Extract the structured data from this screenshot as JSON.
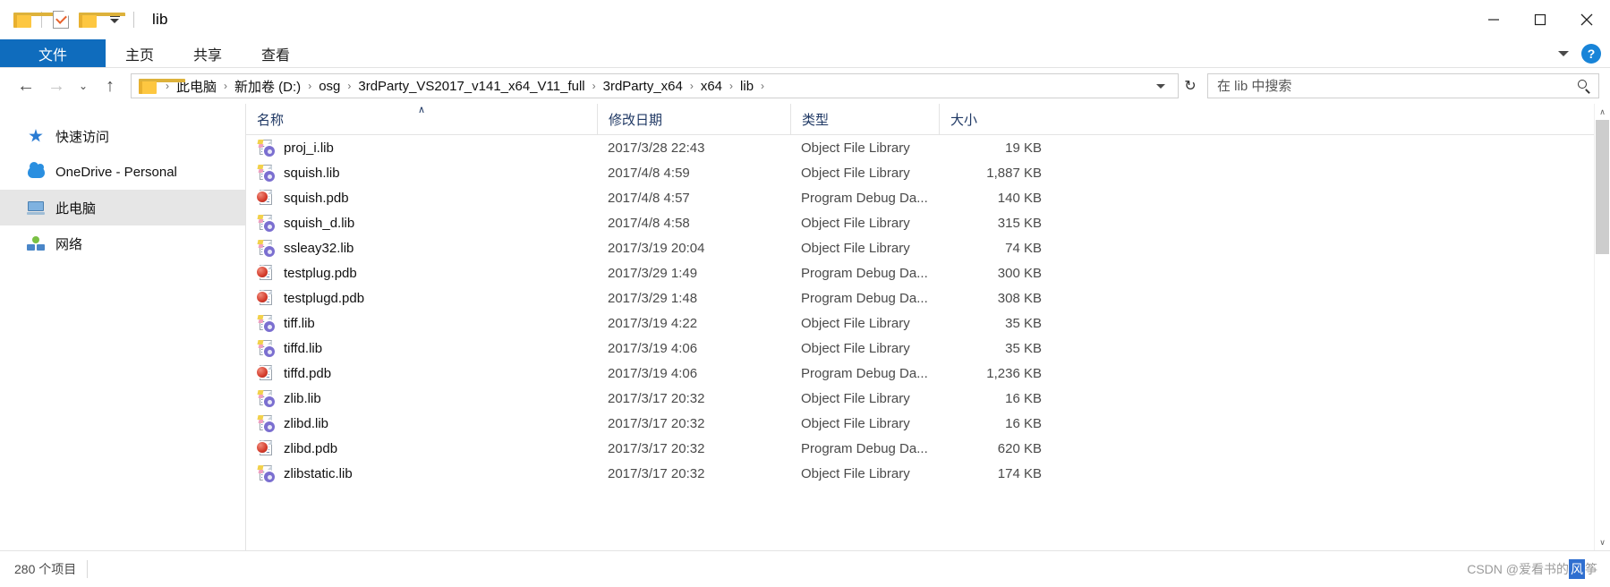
{
  "window": {
    "title": "lib",
    "quick_access": [
      {
        "name": "folder-icon",
        "label": "folder"
      },
      {
        "name": "properties-icon",
        "label": "properties"
      },
      {
        "name": "new-folder-icon",
        "label": "new folder"
      },
      {
        "name": "customize-quick-access-icon",
        "label": "customize"
      }
    ],
    "caption": {
      "minimize": "minimize-button",
      "maximize": "maximize-button",
      "close": "close-button"
    }
  },
  "ribbon": {
    "tabs": [
      {
        "label": "文件",
        "active": true
      },
      {
        "label": "主页",
        "active": false
      },
      {
        "label": "共享",
        "active": false
      },
      {
        "label": "查看",
        "active": false
      }
    ],
    "expand_icon": "chevron-down-icon",
    "help_label": "?"
  },
  "address": {
    "back": "←",
    "forward": "→",
    "recent": "⌄",
    "up": "↑",
    "folder_icon": "folder-icon",
    "crumbs": [
      "此电脑",
      "新加卷 (D:)",
      "osg",
      "3rdParty_VS2017_v141_x64_V11_full",
      "3rdParty_x64",
      "x64",
      "lib"
    ],
    "separator": "›",
    "dropdown_icon": "chevron-down-icon",
    "refresh_icon": "refresh-icon",
    "refresh_glyph": "↻"
  },
  "search": {
    "placeholder": "在 lib 中搜索",
    "value": "",
    "icon": "search-icon"
  },
  "nav_pane": {
    "items": [
      {
        "label": "快速访问",
        "icon": "pin-icon",
        "selected": false
      },
      {
        "label": "OneDrive - Personal",
        "icon": "cloud-icon",
        "selected": false
      },
      {
        "label": "此电脑",
        "icon": "computer-icon",
        "selected": true
      },
      {
        "label": "网络",
        "icon": "network-icon",
        "selected": false
      }
    ]
  },
  "file_list": {
    "columns": [
      {
        "label": "名称",
        "key": "name",
        "sorted": true,
        "sort_glyph": "∧"
      },
      {
        "label": "修改日期",
        "key": "date"
      },
      {
        "label": "类型",
        "key": "type"
      },
      {
        "label": "大小",
        "key": "size"
      }
    ],
    "rows": [
      {
        "name": "proj_i.lib",
        "date": "2017/3/28 22:43",
        "type": "Object File Library",
        "size": "19 KB",
        "icon": "lib-file-icon"
      },
      {
        "name": "squish.lib",
        "date": "2017/4/8 4:59",
        "type": "Object File Library",
        "size": "1,887 KB",
        "icon": "lib-file-icon"
      },
      {
        "name": "squish.pdb",
        "date": "2017/4/8 4:57",
        "type": "Program Debug Da...",
        "size": "140 KB",
        "icon": "pdb-file-icon"
      },
      {
        "name": "squish_d.lib",
        "date": "2017/4/8 4:58",
        "type": "Object File Library",
        "size": "315 KB",
        "icon": "lib-file-icon"
      },
      {
        "name": "ssleay32.lib",
        "date": "2017/3/19 20:04",
        "type": "Object File Library",
        "size": "74 KB",
        "icon": "lib-file-icon"
      },
      {
        "name": "testplug.pdb",
        "date": "2017/3/29 1:49",
        "type": "Program Debug Da...",
        "size": "300 KB",
        "icon": "pdb-file-icon"
      },
      {
        "name": "testplugd.pdb",
        "date": "2017/3/29 1:48",
        "type": "Program Debug Da...",
        "size": "308 KB",
        "icon": "pdb-file-icon"
      },
      {
        "name": "tiff.lib",
        "date": "2017/3/19 4:22",
        "type": "Object File Library",
        "size": "35 KB",
        "icon": "lib-file-icon"
      },
      {
        "name": "tiffd.lib",
        "date": "2017/3/19 4:06",
        "type": "Object File Library",
        "size": "35 KB",
        "icon": "lib-file-icon"
      },
      {
        "name": "tiffd.pdb",
        "date": "2017/3/19 4:06",
        "type": "Program Debug Da...",
        "size": "1,236 KB",
        "icon": "pdb-file-icon"
      },
      {
        "name": "zlib.lib",
        "date": "2017/3/17 20:32",
        "type": "Object File Library",
        "size": "16 KB",
        "icon": "lib-file-icon"
      },
      {
        "name": "zlibd.lib",
        "date": "2017/3/17 20:32",
        "type": "Object File Library",
        "size": "16 KB",
        "icon": "lib-file-icon"
      },
      {
        "name": "zlibd.pdb",
        "date": "2017/3/17 20:32",
        "type": "Program Debug Da...",
        "size": "620 KB",
        "icon": "pdb-file-icon"
      },
      {
        "name": "zlibstatic.lib",
        "date": "2017/3/17 20:32",
        "type": "Object File Library",
        "size": "174 KB",
        "icon": "lib-file-icon"
      }
    ]
  },
  "scrollbar": {
    "up_glyph": "∧",
    "down_glyph": "∨"
  },
  "status": {
    "item_count": "280 个项目"
  },
  "watermark": {
    "prefix": "CSDN @爱看书的",
    "selected": "风",
    "suffix": "筝"
  },
  "colors": {
    "accent": "#0f6cbd",
    "selection": "#2f6fd0",
    "column_header_text": "#1f3864",
    "row_text": "#3a3a3a"
  }
}
